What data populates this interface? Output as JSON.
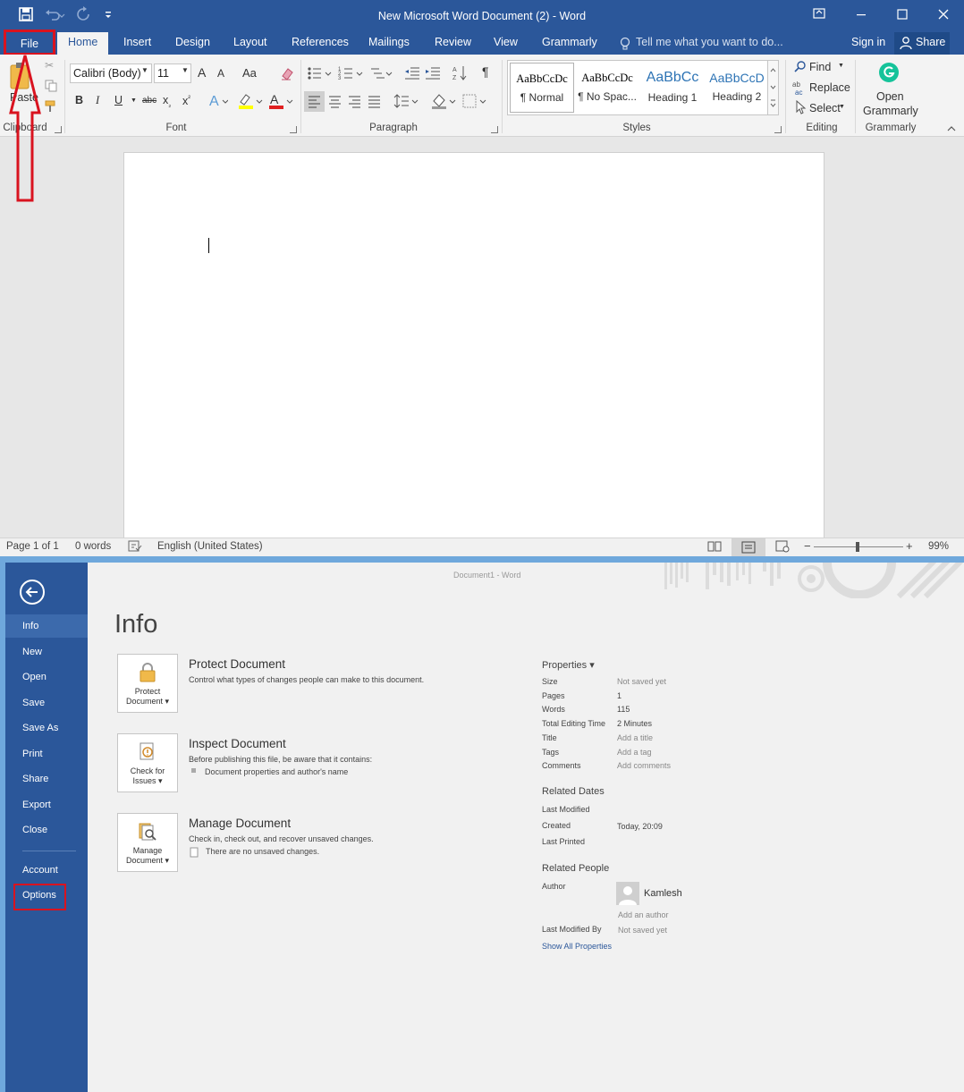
{
  "window": {
    "title": "New Microsoft Word Document (2) - Word"
  },
  "tabs": {
    "file": "File",
    "home": "Home",
    "insert": "Insert",
    "design": "Design",
    "layout": "Layout",
    "references": "References",
    "mailings": "Mailings",
    "review": "Review",
    "view": "View",
    "grammarly": "Grammarly",
    "tell_me": "Tell me what you want to do...",
    "sign_in": "Sign in",
    "share": "Share"
  },
  "ribbon": {
    "clipboard": {
      "paste": "Paste",
      "label": "Clipboard"
    },
    "font": {
      "name": "Calibri (Body)",
      "size": "11",
      "grow": "A",
      "shrink": "A",
      "case": "Aa",
      "bold": "B",
      "italic": "I",
      "underline": "U",
      "strike": "abc",
      "sub": "x",
      "sup": "x",
      "label": "Font"
    },
    "paragraph": {
      "label": "Paragraph"
    },
    "styles": {
      "items": [
        {
          "preview": "AaBbCcDc",
          "name": "¶ Normal"
        },
        {
          "preview": "AaBbCcDc",
          "name": "¶ No Spac..."
        },
        {
          "preview": "AaBbCc",
          "name": "Heading 1"
        },
        {
          "preview": "AaBbCcD",
          "name": "Heading 2"
        }
      ],
      "label": "Styles"
    },
    "editing": {
      "find": "Find",
      "replace": "Replace",
      "select": "Select",
      "label": "Editing"
    },
    "grammarly_group": {
      "open": "Open",
      "name": "Grammarly",
      "label": "Grammarly"
    }
  },
  "status": {
    "page": "Page 1 of 1",
    "words": "0 words",
    "language": "English (United States)",
    "zoom": "99%"
  },
  "backstage": {
    "doc_title": "Document1 - Word",
    "heading": "Info",
    "nav": {
      "info": "Info",
      "new": "New",
      "open": "Open",
      "save": "Save",
      "save_as": "Save As",
      "print": "Print",
      "share": "Share",
      "export": "Export",
      "close": "Close",
      "account": "Account",
      "options": "Options"
    },
    "protect": {
      "caption_1": "Protect",
      "caption_2": "Document ▾",
      "title": "Protect Document",
      "desc": "Control what types of changes people can make to this document."
    },
    "inspect": {
      "caption_1": "Check for",
      "caption_2": "Issues ▾",
      "title": "Inspect Document",
      "desc": "Before publishing this file, be aware that it contains:",
      "bullet": "Document properties and author's name"
    },
    "manage": {
      "caption_1": "Manage",
      "caption_2": "Document ▾",
      "title": "Manage Document",
      "desc": "Check in, check out, and recover unsaved changes.",
      "bullet": "There are no unsaved changes."
    },
    "properties": {
      "heading": "Properties ▾",
      "size_k": "Size",
      "size_v": "Not saved yet",
      "pages_k": "Pages",
      "pages_v": "1",
      "words_k": "Words",
      "words_v": "115",
      "time_k": "Total Editing Time",
      "time_v": "2 Minutes",
      "title_k": "Title",
      "title_v": "Add a title",
      "tags_k": "Tags",
      "tags_v": "Add a tag",
      "comments_k": "Comments",
      "comments_v": "Add comments"
    },
    "dates": {
      "heading": "Related Dates",
      "modified_k": "Last Modified",
      "created_k": "Created",
      "created_v": "Today, 20:09",
      "printed_k": "Last Printed"
    },
    "people": {
      "heading": "Related People",
      "author_k": "Author",
      "author_v": "Kamlesh",
      "add_author": "Add an author",
      "modified_by_k": "Last Modified By",
      "modified_by_v": "Not saved yet",
      "show_all": "Show All Properties"
    }
  },
  "colors": {
    "word_blue": "#2b579a",
    "annotation_red": "#d9131f",
    "heading_blue": "#2e74b5",
    "grammarly_green": "#15c39a"
  }
}
